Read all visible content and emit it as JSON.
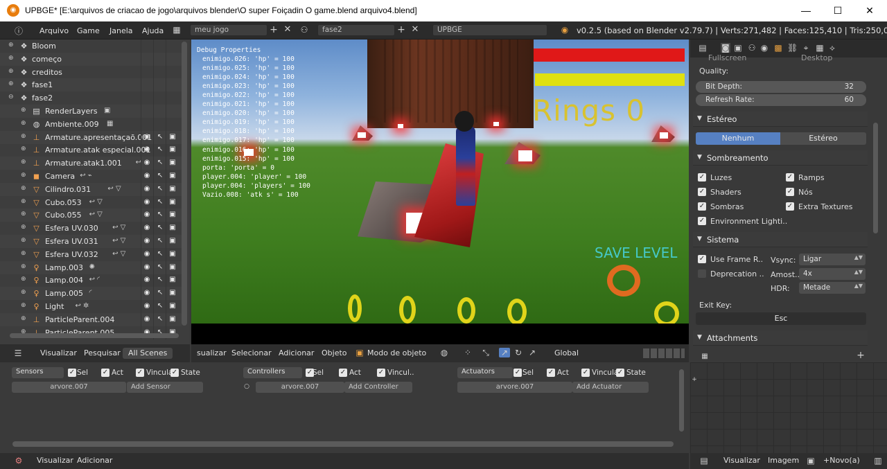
{
  "window": {
    "title": "UPBGE* [E:\\arquivos de criacao de jogo\\arquivos blender\\O super Foiçadin O game.blend arquivo4.blend]",
    "minimize": "—",
    "maximize": "☐",
    "close": "✕"
  },
  "info_header": {
    "menus": [
      "Arquivo",
      "Game",
      "Janela",
      "Ajuda"
    ],
    "screen_name": "meu jogo",
    "scene_name": "fase2",
    "engine": "UPBGE",
    "stats": "v0.2.5 (based on Blender v2.79.7) | Verts:271,482 | Faces:125,410 | Tris:250,081 | Ob"
  },
  "outliner": {
    "items": [
      {
        "name": "Bloom",
        "icon": "scene-icon",
        "level": 0,
        "extra": ""
      },
      {
        "name": "começo",
        "icon": "scene-icon",
        "level": 0,
        "extra": ""
      },
      {
        "name": "creditos",
        "icon": "scene-icon",
        "level": 0,
        "extra": ""
      },
      {
        "name": "fase1",
        "icon": "scene-icon",
        "level": 0,
        "extra": ""
      },
      {
        "name": "fase2",
        "icon": "scene-icon",
        "level": 0,
        "extra": ""
      },
      {
        "name": "RenderLayers",
        "icon": "renderlayer-icon",
        "level": 1,
        "extra": "▣"
      },
      {
        "name": "Ambiente.009",
        "icon": "world-icon",
        "level": 1,
        "extra": "▦"
      },
      {
        "name": "Armature.apresentaçaõ.001",
        "icon": "armature-icon",
        "level": 1,
        "extra": ""
      },
      {
        "name": "Armature.atak especial.001",
        "icon": "armature-icon",
        "level": 1,
        "extra": ""
      },
      {
        "name": "Armature.atak1.001",
        "icon": "armature-icon",
        "level": 1,
        "extra": "↩"
      },
      {
        "name": "Camera",
        "icon": "camera-icon",
        "level": 1,
        "extra": "↩ ⌁"
      },
      {
        "name": "Cilindro.031",
        "icon": "mesh-icon",
        "level": 1,
        "extra": "↩ ▽"
      },
      {
        "name": "Cubo.053",
        "icon": "mesh-icon",
        "level": 1,
        "extra": "↩ ▽"
      },
      {
        "name": "Cubo.055",
        "icon": "mesh-icon",
        "level": 1,
        "extra": "↩ ▽"
      },
      {
        "name": "Esfera UV.030",
        "icon": "mesh-icon",
        "level": 1,
        "extra": "↩ ▽"
      },
      {
        "name": "Esfera UV.031",
        "icon": "mesh-icon",
        "level": 1,
        "extra": "↩ ▽"
      },
      {
        "name": "Esfera UV.032",
        "icon": "mesh-icon",
        "level": 1,
        "extra": "↩ ▽"
      },
      {
        "name": "Lamp.003",
        "icon": "lamp-icon",
        "level": 1,
        "extra": "✺"
      },
      {
        "name": "Lamp.004",
        "icon": "lamp-icon",
        "level": 1,
        "extra": "↩ ◜"
      },
      {
        "name": "Lamp.005",
        "icon": "lamp-icon",
        "level": 1,
        "extra": "◜"
      },
      {
        "name": "Light",
        "icon": "lamp-icon",
        "level": 1,
        "extra": "↩ ✲"
      },
      {
        "name": "ParticleParent.004",
        "icon": "empty-icon",
        "level": 1,
        "extra": ""
      },
      {
        "name": "ParticleParent.005",
        "icon": "empty-icon",
        "level": 1,
        "extra": ""
      }
    ],
    "header_buttons": [
      "Visualizar",
      "Pesquisar",
      "All Scenes"
    ]
  },
  "viewport": {
    "debug_title": "Debug Properties",
    "debug_lines": [
      "enimigo.026: 'hp' = 100",
      "enimigo.025: 'hp' = 100",
      "enimigo.024: 'hp' = 100",
      "enimigo.023: 'hp' = 100",
      "enimigo.022: 'hp' = 100",
      "enimigo.021: 'hp' = 100",
      "enimigo.020: 'hp' = 100",
      "enimigo.019: 'hp' = 100",
      "enimigo.018: 'hp' = 100",
      "enimigo.017: 'hp' = 100",
      "enimigo.016: 'hp' = 100",
      "enimigo.015: 'hp' = 100",
      "porta: 'porta' = 0",
      "player.004: 'player' = 100",
      "player.004: 'players' = 100",
      "Vazio.008: 'atk s' = 100"
    ],
    "rings_text": "Rings 0",
    "save_text": "SAVE LEVEL"
  },
  "viewport_header": {
    "menus": [
      "sualizar",
      "Selecionar",
      "Adicionar",
      "Objeto"
    ],
    "mode": "Modo de objeto",
    "orientation": "Global"
  },
  "properties": {
    "partial_top": "Fullscreen",
    "partial_top_right": "Desktop",
    "quality_label": "Quality:",
    "bit_depth_label": "Bit Depth:",
    "bit_depth_value": "32",
    "refresh_label": "Refresh Rate:",
    "refresh_value": "60",
    "stereo_panel": "Estéreo",
    "stereo_none": "Nenhum",
    "stereo_stereo": "Estéreo",
    "shading_panel": "Sombreamento",
    "shading_checks": [
      {
        "label": "Luzes",
        "checked": true
      },
      {
        "label": "Ramps",
        "checked": true
      },
      {
        "label": "Shaders",
        "checked": true
      },
      {
        "label": "Nós",
        "checked": true
      },
      {
        "label": "Sombras",
        "checked": true
      },
      {
        "label": "Extra Textures",
        "checked": true
      },
      {
        "label": "Environment Lighti..",
        "checked": true
      }
    ],
    "system_panel": "Sistema",
    "use_frame_rate": "Use Frame R..",
    "vsync_label": "Vsync:",
    "vsync_value": "Ligar",
    "deprecation": "Deprecation ..",
    "samples_label": "Amost..",
    "samples_value": "4x",
    "hdr_label": "HDR:",
    "hdr_value": "Metade",
    "exit_key_label": "Exit Key:",
    "exit_key_value": "Esc",
    "attachments_panel": "Attachments"
  },
  "logic": {
    "sensors": {
      "label": "Sensors",
      "sel": "Sel",
      "act": "Act",
      "link": "Vincula",
      "state": "State",
      "object": "arvore.007",
      "add": "Add Sensor"
    },
    "controllers": {
      "label": "Controllers",
      "sel": "Sel",
      "act": "Act",
      "link": "Vincul..",
      "object": "arvore.007",
      "add": "Add Controller"
    },
    "actuators": {
      "label": "Actuators",
      "sel": "Sel",
      "act": "Act",
      "link": "Vincula",
      "state": "State",
      "object": "arvore.007",
      "add": "Add Actuator"
    },
    "header_menus": [
      "Visualizar",
      "Adicionar"
    ]
  },
  "node_header": {
    "menus": [
      "Visualizar",
      "Imagem"
    ],
    "new_button": "Novo(a)"
  }
}
